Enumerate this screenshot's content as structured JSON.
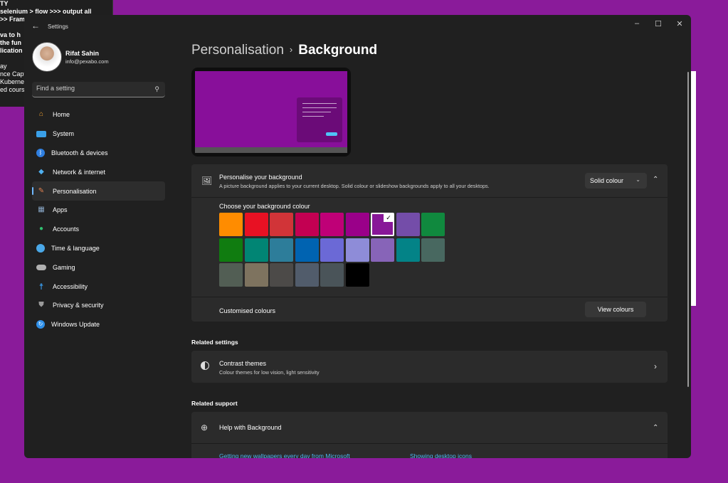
{
  "background_window": {
    "lines": [
      "TY",
      "selenium > flow >>> output all",
      ">> Fram",
      "",
      "va to h",
      " the fun",
      "lication",
      "",
      "ay",
      "nce Capt",
      "Kubernet",
      "ed cours"
    ]
  },
  "window": {
    "title": "Settings",
    "controls": {
      "minimize": "–",
      "maximize": "☐",
      "close": "✕"
    }
  },
  "user": {
    "name": "Rifat Sahin",
    "email": "info@pexabo.com"
  },
  "search": {
    "placeholder": "Find a setting"
  },
  "nav": [
    {
      "label": "Home",
      "icon": "home-icon",
      "color": "#f0a030",
      "selected": false
    },
    {
      "label": "System",
      "icon": "system-icon",
      "color": "#3aa0e8",
      "selected": false
    },
    {
      "label": "Bluetooth & devices",
      "icon": "bluetooth-icon",
      "color": "#2f7fe0",
      "selected": false
    },
    {
      "label": "Network & internet",
      "icon": "wifi-icon",
      "color": "#4fb0f0",
      "selected": false
    },
    {
      "label": "Personalisation",
      "icon": "brush-icon",
      "color": "#e08050",
      "selected": true
    },
    {
      "label": "Apps",
      "icon": "apps-icon",
      "color": "#8aa8c8",
      "selected": false
    },
    {
      "label": "Accounts",
      "icon": "person-icon",
      "color": "#30c070",
      "selected": false
    },
    {
      "label": "Time & language",
      "icon": "globe-clock-icon",
      "color": "#4aa8e8",
      "selected": false
    },
    {
      "label": "Gaming",
      "icon": "controller-icon",
      "color": "#b0b0b0",
      "selected": false
    },
    {
      "label": "Accessibility",
      "icon": "accessibility-icon",
      "color": "#3a9ef0",
      "selected": false
    },
    {
      "label": "Privacy & security",
      "icon": "shield-icon",
      "color": "#9a9a9a",
      "selected": false
    },
    {
      "label": "Windows Update",
      "icon": "update-icon",
      "color": "#2f8fe8",
      "selected": false
    }
  ],
  "breadcrumb": {
    "parent": "Personalisation",
    "separator": "›",
    "current": "Background"
  },
  "personalise": {
    "title": "Personalise your background",
    "description": "A picture background applies to your current desktop. Solid colour or slideshow backgrounds apply to all your desktops.",
    "dropdown_value": "Solid colour"
  },
  "colours": {
    "label": "Choose your background colour",
    "rows": [
      [
        "#ff8c00",
        "#e81123",
        "#d13438",
        "#c30052",
        "#bf0077",
        "#9a0089",
        "#881798",
        "#744da9",
        "#10893e"
      ],
      [
        "#107c10",
        "#018574",
        "#2d7d9a",
        "#0063b1",
        "#6b69d6",
        "#8e8cd8",
        "#8764b8",
        "#038387",
        "#486860"
      ],
      [
        "#525e54",
        "#7e735f",
        "#4c4a48",
        "#515c6b",
        "#4a5459",
        "#000000"
      ]
    ],
    "selected": "#881798"
  },
  "custom_colours": {
    "label": "Customised colours",
    "button": "View colours"
  },
  "related_settings": {
    "header": "Related settings",
    "item_title": "Contrast themes",
    "item_desc": "Colour themes for low vision, light sensitivity"
  },
  "related_support": {
    "header": "Related support",
    "item_title": "Help with Background",
    "links": [
      "Getting new wallpapers every day from Microsoft",
      "Showing desktop icons"
    ]
  }
}
